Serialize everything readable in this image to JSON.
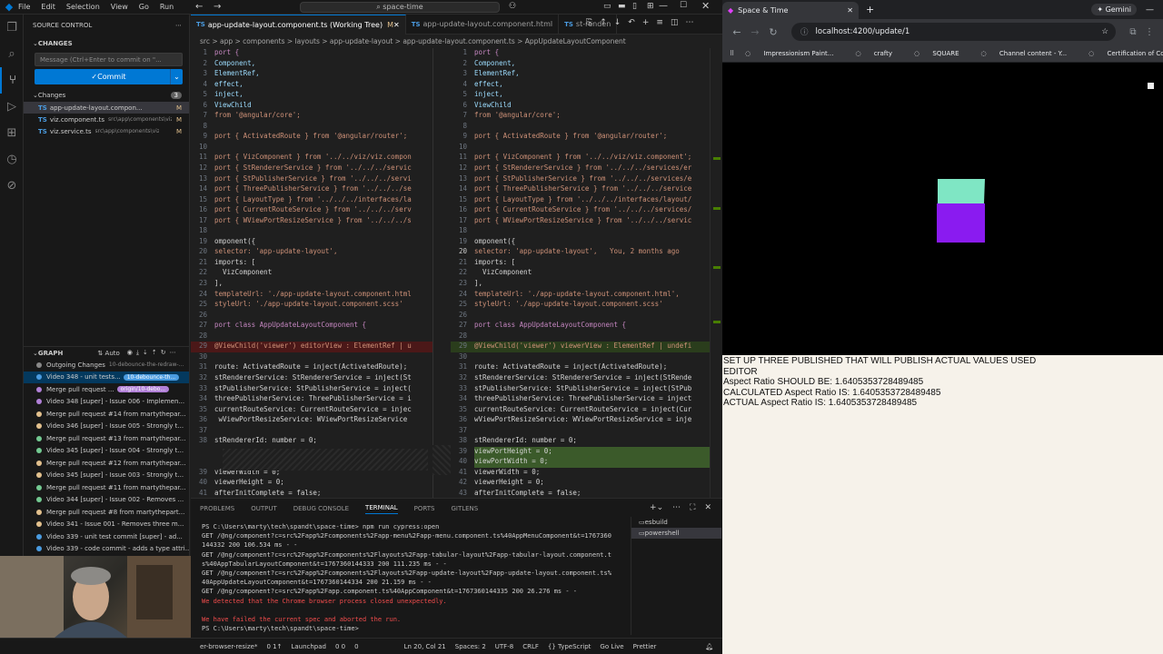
{
  "titlebar": {
    "menu": [
      "File",
      "Edit",
      "Selection",
      "View",
      "Go",
      "Run"
    ],
    "search": "space-time"
  },
  "sidebar": {
    "title": "SOURCE CONTROL",
    "changes_header": "CHANGES",
    "commit_placeholder": "Message (Ctrl+Enter to commit on \"...",
    "commit_label": "Commit",
    "changes_group": "Changes",
    "changes_count": "3",
    "files": [
      {
        "name": "app-update-layout.compon...",
        "path": "",
        "status": "M"
      },
      {
        "name": "viz.component.ts",
        "path": "src\\app\\components\\viz",
        "status": "M"
      },
      {
        "name": "viz.service.ts",
        "path": "src\\app\\components\\viz",
        "status": "M"
      }
    ]
  },
  "graph": {
    "title": "GRAPH",
    "auto": "Auto",
    "items": [
      {
        "text": "Outgoing Changes",
        "extra": "10-debounce-the-redraw-...",
        "color": "#888",
        "badge": ""
      },
      {
        "text": "Video 348 - unit tests...",
        "extra": "",
        "color": "#4a9be0",
        "badge": "10-debounce-th..."
      },
      {
        "text": "Merge pull request ...",
        "extra": "",
        "color": "#b180d7",
        "badge": "origin/10-debo..."
      },
      {
        "text": "Video 348 [super] - Issue 006 - Implemen...",
        "extra": "",
        "color": "#b180d7",
        "badge": ""
      },
      {
        "text": "Merge pull request #14 from martythepar...",
        "extra": "",
        "color": "#e2c08d",
        "badge": ""
      },
      {
        "text": "Video 346 [super] - Issue 005 - Strongly t...",
        "extra": "",
        "color": "#e2c08d",
        "badge": ""
      },
      {
        "text": "Merge pull request #13 from martythepar...",
        "extra": "",
        "color": "#73c991",
        "badge": ""
      },
      {
        "text": "Video 345 [super] - Issue 004 - Strongly t...",
        "extra": "",
        "color": "#73c991",
        "badge": ""
      },
      {
        "text": "Merge pull request #12 from martythepar...",
        "extra": "",
        "color": "#e2c08d",
        "badge": ""
      },
      {
        "text": "Video 345 [super] - Issue 003 - Strongly t...",
        "extra": "",
        "color": "#e2c08d",
        "badge": ""
      },
      {
        "text": "Merge pull request #11 from martythepar...",
        "extra": "",
        "color": "#73c991",
        "badge": ""
      },
      {
        "text": "Video 344 [super] - Issue 002 - Removes ...",
        "extra": "",
        "color": "#73c991",
        "badge": ""
      },
      {
        "text": "Merge pull request #8 from martythepart...",
        "extra": "",
        "color": "#e2c08d",
        "badge": ""
      },
      {
        "text": "Video 341 - Issue 001 - Removes three m...",
        "extra": "",
        "color": "#e2c08d",
        "badge": ""
      },
      {
        "text": "Video 339 - unit test commit [super] - ad...",
        "extra": "",
        "color": "#4a9be0",
        "badge": ""
      },
      {
        "text": "Video 339 - code commit - adds a type attri...",
        "extra": "",
        "color": "#4a9be0",
        "badge": ""
      }
    ]
  },
  "editor": {
    "tabs": [
      {
        "label": "app-update-layout.component.ts (Working Tree)",
        "mod": "M",
        "active": true
      },
      {
        "label": "app-update-layout.component.html",
        "mod": "",
        "active": false
      },
      {
        "label": "st-renden",
        "mod": "",
        "active": false
      }
    ],
    "breadcrumb": "src > app > components > layouts > app-update-layout > app-update-layout.component.ts > AppUpdateLayoutComponent",
    "left_lines": [
      {
        "n": "1",
        "t": "port {"
      },
      {
        "n": "2",
        "t": "Component,"
      },
      {
        "n": "3",
        "t": "ElementRef,"
      },
      {
        "n": "4",
        "t": "effect,"
      },
      {
        "n": "5",
        "t": "inject,"
      },
      {
        "n": "6",
        "t": "ViewChild"
      },
      {
        "n": "7",
        "t": "from '@angular/core';"
      },
      {
        "n": "8",
        "t": ""
      },
      {
        "n": "9",
        "t": "port { ActivatedRoute } from '@angular/router';"
      },
      {
        "n": "10",
        "t": ""
      },
      {
        "n": "11",
        "t": "port { VizComponent } from '../../viz/viz.compon"
      },
      {
        "n": "12",
        "t": "port { StRendererService } from '../../../servic"
      },
      {
        "n": "13",
        "t": "port { StPublisherService } from '../../../servi"
      },
      {
        "n": "14",
        "t": "port { ThreePublisherService } from '../../../se"
      },
      {
        "n": "15",
        "t": "port { LayoutType } from '../../../interfaces/la"
      },
      {
        "n": "16",
        "t": "port { CurrentRouteService } from '../../../serv"
      },
      {
        "n": "17",
        "t": "port { WViewPortResizeService } from '../../../s"
      },
      {
        "n": "18",
        "t": ""
      },
      {
        "n": "19",
        "t": "omponent({"
      },
      {
        "n": "20",
        "t": "selector: 'app-update-layout',"
      },
      {
        "n": "21",
        "t": "imports: ["
      },
      {
        "n": "22",
        "t": "  VizComponent"
      },
      {
        "n": "23",
        "t": "],"
      },
      {
        "n": "24",
        "t": "templateUrl: './app-update-layout.component.html"
      },
      {
        "n": "25",
        "t": "styleUrl: './app-update-layout.component.scss'"
      },
      {
        "n": "26",
        "t": ""
      },
      {
        "n": "27",
        "t": "port class AppUpdateLayoutComponent {"
      },
      {
        "n": "28",
        "t": ""
      },
      {
        "n": "29",
        "t": "@ViewChild('viewer') editorView : ElementRef | u"
      },
      {
        "n": "30",
        "t": ""
      },
      {
        "n": "31",
        "t": "route: ActivatedRoute = inject(ActivatedRoute);"
      },
      {
        "n": "32",
        "t": "stRendererService: StRendererService = inject(St"
      },
      {
        "n": "33",
        "t": "stPublisherService: StPublisherService = inject("
      },
      {
        "n": "34",
        "t": "threePublisherService: ThreePublisherService = i"
      },
      {
        "n": "35",
        "t": "currentRouteService: CurrentRouteService = injec"
      },
      {
        "n": "36",
        "t": " wViewPortResizeService: WViewPortResizeService"
      },
      {
        "n": "37",
        "t": ""
      },
      {
        "n": "38",
        "t": "stRendererId: number = 0;"
      },
      {
        "n": "",
        "t": ""
      },
      {
        "n": "",
        "t": ""
      },
      {
        "n": "39",
        "t": "viewerWidth = 0;"
      },
      {
        "n": "40",
        "t": "viewerHeight = 0;"
      },
      {
        "n": "41",
        "t": "afterInitComplete = false;"
      }
    ],
    "right_lines": [
      {
        "n": "1",
        "t": "port {"
      },
      {
        "n": "2",
        "t": "Component,"
      },
      {
        "n": "3",
        "t": "ElementRef,"
      },
      {
        "n": "4",
        "t": "effect,"
      },
      {
        "n": "5",
        "t": "inject,"
      },
      {
        "n": "6",
        "t": "ViewChild"
      },
      {
        "n": "7",
        "t": "from '@angular/core';"
      },
      {
        "n": "8",
        "t": ""
      },
      {
        "n": "9",
        "t": "port { ActivatedRoute } from '@angular/router';"
      },
      {
        "n": "10",
        "t": ""
      },
      {
        "n": "11",
        "t": "port { VizComponent } from '../../viz/viz.component';"
      },
      {
        "n": "12",
        "t": "port { StRendererService } from '../../../services/er"
      },
      {
        "n": "13",
        "t": "port { StPublisherService } from '../../../services/e"
      },
      {
        "n": "14",
        "t": "port { ThreePublisherService } from '../../../service"
      },
      {
        "n": "15",
        "t": "port { LayoutType } from '../../../interfaces/layout/"
      },
      {
        "n": "16",
        "t": "port { CurrentRouteService } from '../../../services/"
      },
      {
        "n": "17",
        "t": "port { WViewPortResizeService } from '../../../servic"
      },
      {
        "n": "18",
        "t": ""
      },
      {
        "n": "19",
        "t": "omponent({"
      },
      {
        "n": "20",
        "t": "selector: 'app-update-layout',   You, 2 months ago"
      },
      {
        "n": "21",
        "t": "imports: ["
      },
      {
        "n": "22",
        "t": "  VizComponent"
      },
      {
        "n": "23",
        "t": "],"
      },
      {
        "n": "24",
        "t": "templateUrl: './app-update-layout.component.html',"
      },
      {
        "n": "25",
        "t": "styleUrl: './app-update-layout.component.scss'"
      },
      {
        "n": "26",
        "t": ""
      },
      {
        "n": "27",
        "t": "port class AppUpdateLayoutComponent {"
      },
      {
        "n": "28",
        "t": ""
      },
      {
        "n": "29",
        "t": "@ViewChild('viewer') viewerView : ElementRef | undefi"
      },
      {
        "n": "30",
        "t": ""
      },
      {
        "n": "31",
        "t": "route: ActivatedRoute = inject(ActivatedRoute);"
      },
      {
        "n": "32",
        "t": "stRendererService: StRendererService = inject(StRende"
      },
      {
        "n": "33",
        "t": "stPublisherService: StPublisherService = inject(StPub"
      },
      {
        "n": "34",
        "t": "threePublisherService: ThreePublisherService = inject"
      },
      {
        "n": "35",
        "t": "currentRouteService: CurrentRouteService = inject(Cur"
      },
      {
        "n": "36",
        "t": "wViewPortResizeService: WViewPortResizeService = inje"
      },
      {
        "n": "37",
        "t": ""
      },
      {
        "n": "38",
        "t": "stRendererId: number = 0;"
      },
      {
        "n": "39",
        "t": "viewPortHeight = 0;"
      },
      {
        "n": "40",
        "t": "viewPortWidth = 0;"
      },
      {
        "n": "41",
        "t": "viewerWidth = 0;"
      },
      {
        "n": "42",
        "t": "viewerHeight = 0;"
      },
      {
        "n": "43",
        "t": "afterInitComplete = false;"
      }
    ]
  },
  "panel": {
    "tabs": [
      "PROBLEMS",
      "OUTPUT",
      "DEBUG CONSOLE",
      "TERMINAL",
      "PORTS",
      "GITLENS"
    ],
    "terminal_lines": [
      {
        "t": "PS C:\\Users\\marty\\tech\\spandt\\space-time> npm run cypress:open",
        "c": "#ccc"
      },
      {
        "t": "GET /@ng/component?c=src%2Fapp%2Fcomponents%2Fapp-menu%2Fapp-menu.component.ts%40AppMenuComponent&t=1767360",
        "c": "#ccc"
      },
      {
        "t": "144332 200 106.534 ms - -",
        "c": "#ccc"
      },
      {
        "t": "GET /@ng/component?c=src%2Fapp%2Fcomponents%2Flayouts%2Fapp-tabular-layout%2Fapp-tabular-layout.component.t",
        "c": "#ccc"
      },
      {
        "t": "s%40AppTabularLayoutComponent&t=1767360144333 200 111.235 ms - -",
        "c": "#ccc"
      },
      {
        "t": "GET /@ng/component?c=src%2Fapp%2Fcomponents%2Flayouts%2Fapp-update-layout%2Fapp-update-layout.component.ts%",
        "c": "#ccc"
      },
      {
        "t": "40AppUpdateLayoutComponent&t=1767360144334 200 21.159 ms - -",
        "c": "#ccc"
      },
      {
        "t": "GET /@ng/component?c=src%2Fapp%2Fapp.component.ts%40AppComponent&t=1767360144335 200 26.276 ms - -",
        "c": "#ccc"
      },
      {
        "t": "We detected that the Chrome browser process closed unexpectedly.",
        "c": "#f14c4c"
      },
      {
        "t": "",
        "c": "#ccc"
      },
      {
        "t": "We have failed the current spec and aborted the run.",
        "c": "#f14c4c"
      },
      {
        "t": "PS C:\\Users\\marty\\tech\\spandt\\space-time> ",
        "c": "#ccc"
      }
    ],
    "term_list": [
      "esbuild",
      "powershell"
    ]
  },
  "statusbar": {
    "items": [
      "er-browser-resize*",
      "0 1↑",
      "Launchpad",
      "0 0",
      "0",
      "Ln 20, Col 21",
      "Spaces: 2",
      "UTF-8",
      "CRLF",
      "{} TypeScript",
      "Go Live",
      "Prettier"
    ]
  },
  "browser": {
    "tab_title": "Space & Time",
    "gemini": "Gemini",
    "url": "localhost:4200/update/1",
    "bookmarks": [
      "Impressionism Paint...",
      "crafty",
      "SQUARE",
      "Channel content - Y...",
      "Certification of Com..."
    ],
    "info_lines": [
      "SET UP THREE PUBLISHED THAT WILL PUBLISH ACTUAL VALUES USED",
      "EDITOR",
      "Aspect Ratio SHOULD BE: 1.6405353728489485",
      "CALCULATED Aspect Ratio IS: 1.6405353728489485",
      "ACTUAL Aspect Ratio IS: 1.6405353728489485"
    ],
    "cube_top": "#7fe6c4",
    "cube_front": "#8a1bf0"
  }
}
